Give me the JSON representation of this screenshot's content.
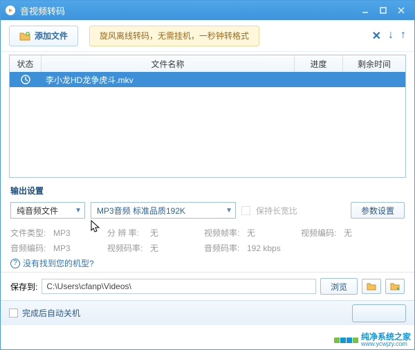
{
  "title": "音视频转码",
  "toolbar": {
    "add_label": "添加文件",
    "banner": "旋风离线转码，无需挂机，一秒钟转格式"
  },
  "table": {
    "headers": {
      "status": "状态",
      "name": "文件名称",
      "progress": "进度",
      "time": "剩余时间"
    },
    "rows": [
      {
        "name": "李小龙HD龙争虎斗.mkv"
      }
    ]
  },
  "output": {
    "section_title": "输出设置",
    "type_select": "纯音频文件",
    "format_select": "MP3音频 标准品质192K",
    "keep_ratio": "保持长宽比",
    "param_btn": "参数设置",
    "info": {
      "file_type_label": "文件类型:",
      "file_type": "MP3",
      "resolution_label": "分 辨 率:",
      "resolution": "无",
      "vfps_label": "视频帧率:",
      "vfps": "无",
      "vcodec_label": "视频编码:",
      "vcodec": "无",
      "acodec_label": "音频编码:",
      "acodec": "MP3",
      "vbitrate_label": "视频码率:",
      "vbitrate": "无",
      "abitrate_label": "音频码率:",
      "abitrate": "192 kbps"
    },
    "help_link": "没有找到您的机型?"
  },
  "save": {
    "label": "保存到:",
    "path": "C:\\Users\\cfanp\\Videos\\",
    "browse": "浏览"
  },
  "footer": {
    "shutdown": "完成后自动关机"
  },
  "watermark": {
    "text": "纯净系统之家",
    "url": "www.ycwjzy.com"
  }
}
